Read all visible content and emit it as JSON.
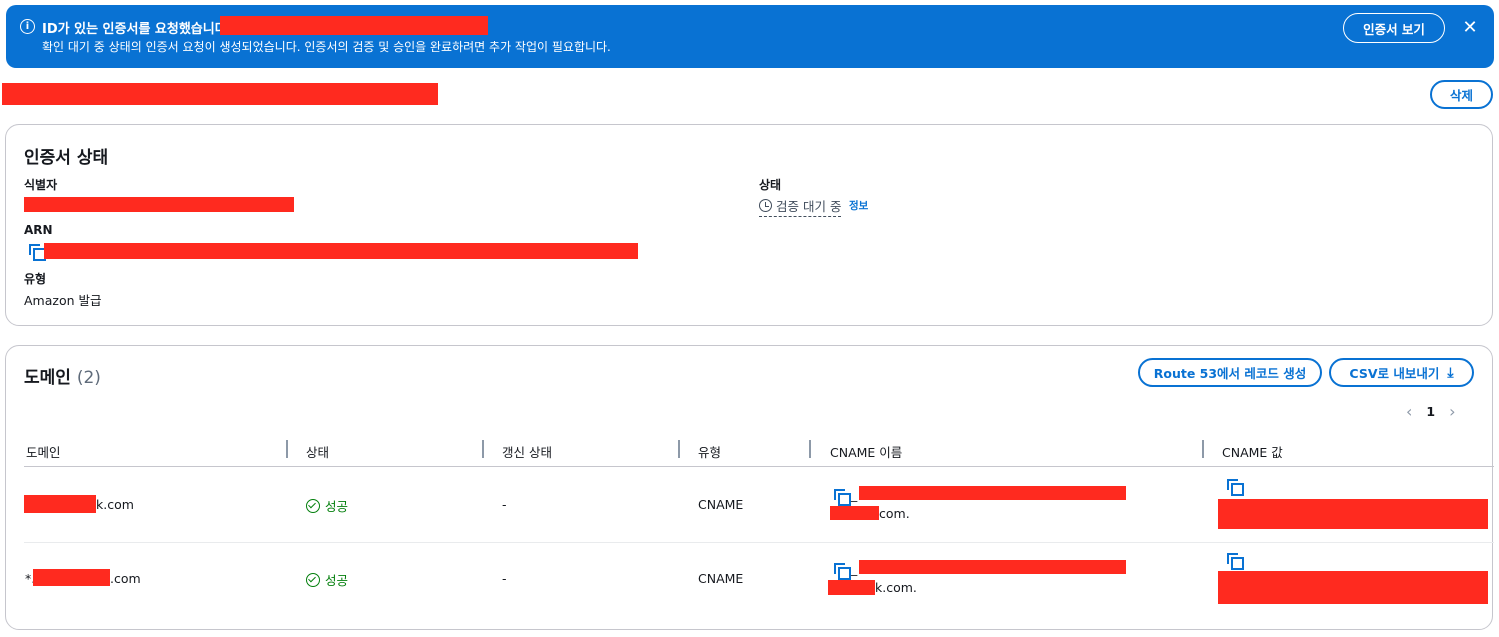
{
  "flash": {
    "title": "ID가 있는 인증서를 요청했습니다.",
    "message": "확인 대기 중 상태의 인증서 요청이 생성되었습니다. 인증서의 검증 및 승인을 완료하려면 추가 작업이 필요합니다.",
    "view_button": "인증서 보기",
    "close_icon": "close-icon",
    "info_icon": "info-icon"
  },
  "header": {
    "delete_button": "삭제"
  },
  "status_card": {
    "title": "인증서 상태",
    "identifier_label": "식별자",
    "arn_label": "ARN",
    "type_label": "유형",
    "type_value": "Amazon 발급",
    "status_label": "상태",
    "status_value": "검증 대기 중",
    "info_link": "정보",
    "status_icon": "clock-icon"
  },
  "domains": {
    "title": "도메인",
    "count": "(2)",
    "route53_button": "Route 53에서 레코드 생성",
    "csv_button": "CSV로 내보내기",
    "page": "1",
    "columns": [
      "도메인",
      "상태",
      "갱신 상태",
      "유형",
      "CNAME 이름",
      "CNAME 값"
    ],
    "rows": [
      {
        "domain_suffix": "k.com",
        "status": "성공",
        "renewal": "-",
        "type": "CNAME",
        "cname_name_prefix": "_",
        "cname_name_suffix": "com."
      },
      {
        "domain_prefix": "*.",
        "domain_suffix": ".com",
        "status": "성공",
        "renewal": "-",
        "type": "CNAME",
        "cname_name_prefix": "_",
        "cname_name_suffix": "k.com."
      }
    ]
  },
  "colors": {
    "accent": "#0972d3",
    "success": "#037f0c",
    "redaction": "#ff2a1f"
  }
}
